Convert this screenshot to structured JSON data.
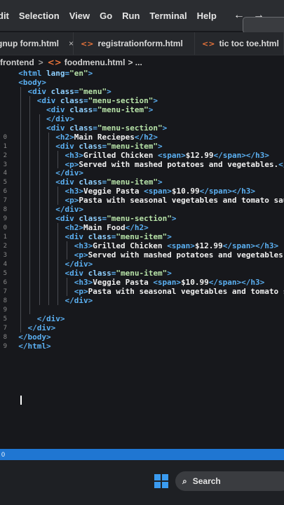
{
  "menubar": {
    "items": [
      "dit",
      "Selection",
      "View",
      "Go",
      "Run",
      "Terminal",
      "Help"
    ],
    "back_arrow": "←",
    "forward_arrow": "→"
  },
  "tabs": [
    {
      "label": "gnup form.html",
      "icon": "html-file-icon"
    },
    {
      "label": "registrationform.html",
      "icon": "html-file-icon"
    },
    {
      "label": "tic toc toe.html",
      "icon": "html-file-icon"
    }
  ],
  "tab_close": "×",
  "breadcrumb": {
    "folder": "frontend",
    "separator": ">",
    "file": "foodmenu.html",
    "rest": "> ..."
  },
  "gutter": [
    "",
    "",
    "",
    "",
    "",
    "",
    "",
    "",
    "",
    "",
    "",
    "",
    "",
    "",
    "",
    "",
    "",
    "",
    "",
    "",
    "",
    "",
    "1",
    "2",
    "3",
    "4",
    "5",
    "6",
    "7",
    "8",
    "9",
    "0",
    "1",
    "2",
    "3",
    "4",
    "5",
    "6",
    "7",
    "8",
    "9"
  ],
  "gutter_numbers": [
    "",
    "",
    "",
    "",
    "",
    "",
    "",
    "",
    "",
    "",
    "",
    "",
    "",
    "",
    "",
    "",
    "",
    "",
    "",
    "",
    "",
    "",
    "",
    "",
    "",
    "",
    "",
    "",
    "",
    "",
    "",
    "",
    "",
    "",
    "",
    "",
    "",
    "",
    "",
    ""
  ],
  "visible_line_numbers": [
    "",
    "",
    "",
    "",
    "",
    "",
    "",
    "0",
    "1",
    "2",
    "3",
    "4",
    "5",
    "6",
    "7",
    "8",
    "9",
    "0",
    "1",
    "2",
    "3",
    "4",
    "5",
    "6",
    "7",
    "8",
    "9",
    "5",
    "7",
    "8",
    "9"
  ],
  "code_lines": [
    {
      "indent": "  ",
      "parts": [
        [
          "tag",
          "<html "
        ],
        [
          "attr",
          "lang"
        ],
        [
          "tag",
          "="
        ],
        [
          "str",
          "\"en\""
        ],
        [
          "tag",
          ">"
        ]
      ]
    },
    {
      "indent": "  ",
      "parts": [
        [
          "tag",
          "<body>"
        ]
      ]
    },
    {
      "indent": "    ",
      "parts": [
        [
          "tag",
          "<div "
        ],
        [
          "attr",
          "class"
        ],
        [
          "tag",
          "="
        ],
        [
          "str",
          "\"menu\""
        ],
        [
          "tag",
          ">"
        ]
      ]
    },
    {
      "indent": "      ",
      "parts": [
        [
          "tag",
          "<div "
        ],
        [
          "attr",
          "class"
        ],
        [
          "tag",
          "="
        ],
        [
          "str",
          "\"menu-section\""
        ],
        [
          "tag",
          ">"
        ]
      ]
    },
    {
      "indent": "        ",
      "parts": [
        [
          "tag",
          "<div "
        ],
        [
          "attr",
          "class"
        ],
        [
          "tag",
          "="
        ],
        [
          "str",
          "\"menu-item\""
        ],
        [
          "tag",
          ">"
        ]
      ]
    },
    {
      "indent": "        ",
      "parts": [
        [
          "tag",
          "</div>"
        ]
      ]
    },
    {
      "indent": "        ",
      "parts": [
        [
          "tag",
          "<div "
        ],
        [
          "attr",
          "class"
        ],
        [
          "tag",
          "="
        ],
        [
          "str",
          "\"menu-section\""
        ],
        [
          "tag",
          ">"
        ]
      ]
    },
    {
      "indent": "          ",
      "parts": [
        [
          "tag",
          "<h2>"
        ],
        [
          "txt",
          "Main Reciepes"
        ],
        [
          "tag",
          "</h2>"
        ]
      ]
    },
    {
      "indent": "          ",
      "parts": [
        [
          "tag",
          "<div "
        ],
        [
          "attr",
          "class"
        ],
        [
          "tag",
          "="
        ],
        [
          "str",
          "\"menu-item\""
        ],
        [
          "tag",
          ">"
        ]
      ]
    },
    {
      "indent": "            ",
      "parts": [
        [
          "tag",
          "<h3>"
        ],
        [
          "txt",
          "Grilled Chicken "
        ],
        [
          "tag",
          "<span>"
        ],
        [
          "txt",
          "$12.99"
        ],
        [
          "tag",
          "</span></h3>"
        ]
      ]
    },
    {
      "indent": "            ",
      "parts": [
        [
          "tag",
          "<p>"
        ],
        [
          "txt",
          "Served with mashed potatoes and vegetables."
        ],
        [
          "tag",
          "</p"
        ]
      ]
    },
    {
      "indent": "          ",
      "parts": [
        [
          "tag",
          "</div>"
        ]
      ]
    },
    {
      "indent": "          ",
      "parts": [
        [
          "tag",
          "<div "
        ],
        [
          "attr",
          "class"
        ],
        [
          "tag",
          "="
        ],
        [
          "str",
          "\"menu-item\""
        ],
        [
          "tag",
          ">"
        ]
      ]
    },
    {
      "indent": "            ",
      "parts": [
        [
          "tag",
          "<h3>"
        ],
        [
          "txt",
          "Veggie Pasta "
        ],
        [
          "tag",
          "<span>"
        ],
        [
          "txt",
          "$10.99"
        ],
        [
          "tag",
          "</span></h3>"
        ]
      ]
    },
    {
      "indent": "            ",
      "parts": [
        [
          "tag",
          "<p>"
        ],
        [
          "txt",
          "Pasta with seasonal vegetables and tomato sauce"
        ]
      ]
    },
    {
      "indent": "          ",
      "parts": [
        [
          "tag",
          "</div>"
        ]
      ]
    },
    {
      "indent": "          ",
      "parts": [
        [
          "tag",
          "<div "
        ],
        [
          "attr",
          "class"
        ],
        [
          "tag",
          "="
        ],
        [
          "str",
          "\"menu-section\""
        ],
        [
          "tag",
          ">"
        ]
      ]
    },
    {
      "indent": "            ",
      "parts": [
        [
          "tag",
          "<h2>"
        ],
        [
          "txt",
          "Main Food"
        ],
        [
          "tag",
          "</h2>"
        ]
      ]
    },
    {
      "indent": "            ",
      "parts": [
        [
          "tag",
          "<div "
        ],
        [
          "attr",
          "class"
        ],
        [
          "tag",
          "="
        ],
        [
          "str",
          "\"menu-item\""
        ],
        [
          "tag",
          ">"
        ]
      ]
    },
    {
      "indent": "              ",
      "parts": [
        [
          "tag",
          "<h3>"
        ],
        [
          "txt",
          "Grilled Chicken "
        ],
        [
          "tag",
          "<span>"
        ],
        [
          "txt",
          "$12.99"
        ],
        [
          "tag",
          "</span></h3>"
        ]
      ]
    },
    {
      "indent": "              ",
      "parts": [
        [
          "tag",
          "<p>"
        ],
        [
          "txt",
          "Served with mashed potatoes and vegetables."
        ],
        [
          "tag",
          "</"
        ]
      ]
    },
    {
      "indent": "            ",
      "parts": [
        [
          "tag",
          "</div>"
        ]
      ]
    },
    {
      "indent": "            ",
      "parts": [
        [
          "tag",
          "<div "
        ],
        [
          "attr",
          "class"
        ],
        [
          "tag",
          "="
        ],
        [
          "str",
          "\"menu-item\""
        ],
        [
          "tag",
          ">"
        ]
      ]
    },
    {
      "indent": "              ",
      "parts": [
        [
          "tag",
          "<h3>"
        ],
        [
          "txt",
          "Veggie Pasta "
        ],
        [
          "tag",
          "<span>"
        ],
        [
          "txt",
          "$10.99"
        ],
        [
          "tag",
          "</span></h3>"
        ]
      ]
    },
    {
      "indent": "              ",
      "parts": [
        [
          "tag",
          "<p>"
        ],
        [
          "txt",
          "Pasta with seasonal vegetables and tomato sauce"
        ]
      ]
    },
    {
      "indent": "            ",
      "parts": [
        [
          "tag",
          "</div>"
        ]
      ]
    },
    {
      "indent": "",
      "parts": [
        [
          "txt",
          ""
        ]
      ]
    },
    {
      "indent": "      ",
      "parts": [
        [
          "tag",
          "</div>"
        ]
      ]
    },
    {
      "indent": "    ",
      "parts": [
        [
          "tag",
          "</div>"
        ]
      ]
    },
    {
      "indent": "  ",
      "parts": [
        [
          "tag",
          "</body>"
        ]
      ]
    },
    {
      "indent": "  ",
      "parts": [
        [
          "tag",
          "</html>"
        ]
      ]
    },
    {
      "indent": "",
      "parts": [
        [
          "txt",
          ""
        ]
      ]
    }
  ],
  "status_text": "0",
  "taskbar": {
    "search_label": "Search"
  },
  "colors": {
    "tag": "#5bb0f2",
    "attr": "#8fd0ff",
    "string": "#b7e3a8",
    "accent": "#1f76d2"
  }
}
